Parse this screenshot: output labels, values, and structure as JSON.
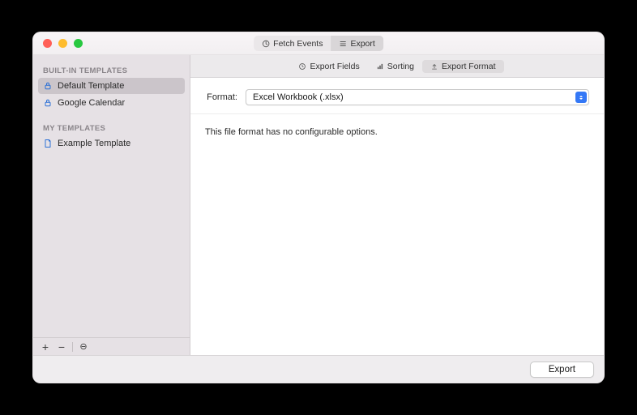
{
  "toolbar": {
    "fetch_label": "Fetch Events",
    "export_label": "Export"
  },
  "sidebar": {
    "section_builtin": "BUILT-IN TEMPLATES",
    "section_my": "MY TEMPLATES",
    "items_builtin": [
      {
        "label": "Default Template"
      },
      {
        "label": "Google Calendar"
      }
    ],
    "items_my": [
      {
        "label": "Example Template"
      }
    ],
    "footer": {
      "add": "+",
      "remove": "−",
      "action": "⊖"
    }
  },
  "tabs": {
    "fields": "Export Fields",
    "sorting": "Sorting",
    "format": "Export Format"
  },
  "form": {
    "format_label": "Format:",
    "format_value": "Excel Workbook (.xlsx)",
    "note": "This file format has no configurable options."
  },
  "footer": {
    "export": "Export"
  }
}
